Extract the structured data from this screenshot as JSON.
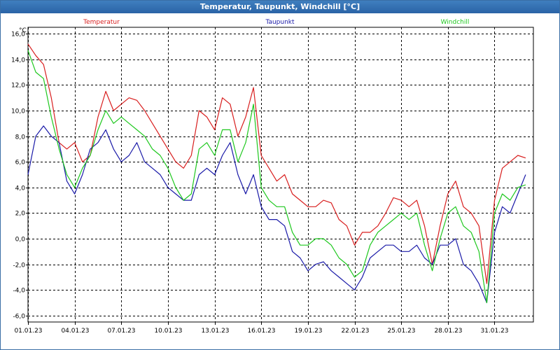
{
  "window": {
    "title": "Temperatur, Taupunkt, Windchill [°C]"
  },
  "colors": {
    "temperatur": "#d81e1e",
    "taupunkt": "#1a1aa8",
    "windchill": "#1ec81e",
    "grid": "#000000",
    "axis": "#000000"
  },
  "chart_data": {
    "type": "line",
    "title": "Temperatur, Taupunkt, Windchill [°C]",
    "unit": "°C",
    "xlabel": "",
    "ylabel": "°C",
    "ylim": [
      -6.5,
      16.5
    ],
    "xlim": [
      0,
      32.5
    ],
    "grid": true,
    "legend_position": "top",
    "x_ticks": [
      {
        "x": 0,
        "label": "01.01.23"
      },
      {
        "x": 3,
        "label": "04.01.23"
      },
      {
        "x": 6,
        "label": "07.01.23"
      },
      {
        "x": 9,
        "label": "10.01.23"
      },
      {
        "x": 12,
        "label": "13.01.23"
      },
      {
        "x": 15,
        "label": "16.01.23"
      },
      {
        "x": 18,
        "label": "19.01.23"
      },
      {
        "x": 21,
        "label": "22.01.23"
      },
      {
        "x": 24,
        "label": "25.01.23"
      },
      {
        "x": 27,
        "label": "28.01.23"
      },
      {
        "x": 30,
        "label": "31.01.23"
      }
    ],
    "y_ticks": [
      {
        "y": 16,
        "label": "16,0"
      },
      {
        "y": 14,
        "label": "14,0"
      },
      {
        "y": 12,
        "label": "12,0"
      },
      {
        "y": 10,
        "label": "10,0"
      },
      {
        "y": 8,
        "label": "8,0"
      },
      {
        "y": 6,
        "label": "6,0"
      },
      {
        "y": 4,
        "label": "4,0"
      },
      {
        "y": 2,
        "label": "2,0"
      },
      {
        "y": 0,
        "label": "0,0"
      },
      {
        "y": -2,
        "label": "-2,0"
      },
      {
        "y": -4,
        "label": "-4,0"
      },
      {
        "y": -6,
        "label": "-6,0"
      }
    ],
    "series": [
      {
        "name": "Temperatur",
        "color": "#d81e1e",
        "points": [
          [
            0,
            15.2
          ],
          [
            0.5,
            14.3
          ],
          [
            1,
            13.6
          ],
          [
            1.5,
            11.0
          ],
          [
            2,
            7.5
          ],
          [
            2.5,
            7.0
          ],
          [
            3,
            7.5
          ],
          [
            3.5,
            6.0
          ],
          [
            4,
            6.5
          ],
          [
            4.5,
            9.5
          ],
          [
            5,
            11.5
          ],
          [
            5.5,
            10.0
          ],
          [
            6,
            10.5
          ],
          [
            6.5,
            11.0
          ],
          [
            7,
            10.8
          ],
          [
            7.5,
            10.0
          ],
          [
            8,
            9.0
          ],
          [
            8.5,
            8.0
          ],
          [
            9,
            7.0
          ],
          [
            9.5,
            6.0
          ],
          [
            10,
            5.5
          ],
          [
            10.5,
            6.5
          ],
          [
            11,
            10.0
          ],
          [
            11.5,
            9.5
          ],
          [
            12,
            8.5
          ],
          [
            12.5,
            11.0
          ],
          [
            13,
            10.5
          ],
          [
            13.5,
            8.0
          ],
          [
            14,
            9.5
          ],
          [
            14.5,
            11.8
          ],
          [
            15,
            6.5
          ],
          [
            15.5,
            5.5
          ],
          [
            16,
            4.5
          ],
          [
            16.5,
            5.0
          ],
          [
            17,
            3.5
          ],
          [
            17.5,
            3.0
          ],
          [
            18,
            2.5
          ],
          [
            18.5,
            2.5
          ],
          [
            19,
            3.0
          ],
          [
            19.5,
            2.8
          ],
          [
            20,
            1.5
          ],
          [
            20.5,
            1.0
          ],
          [
            21,
            -0.5
          ],
          [
            21.5,
            0.5
          ],
          [
            22,
            0.5
          ],
          [
            22.5,
            1.0
          ],
          [
            23,
            2.0
          ],
          [
            23.5,
            3.2
          ],
          [
            24,
            3.0
          ],
          [
            24.5,
            2.5
          ],
          [
            25,
            3.0
          ],
          [
            25.5,
            1.0
          ],
          [
            26,
            -2.0
          ],
          [
            26.5,
            1.0
          ],
          [
            27,
            3.5
          ],
          [
            27.5,
            4.5
          ],
          [
            28,
            2.5
          ],
          [
            28.5,
            2.0
          ],
          [
            29,
            1.0
          ],
          [
            29.5,
            -3.5
          ],
          [
            30,
            3.0
          ],
          [
            30.5,
            5.5
          ],
          [
            31,
            6.0
          ],
          [
            31.5,
            6.5
          ],
          [
            32,
            6.3
          ]
        ]
      },
      {
        "name": "Taupunkt",
        "color": "#1a1aa8",
        "points": [
          [
            0,
            5.0
          ],
          [
            0.5,
            8.0
          ],
          [
            1,
            8.8
          ],
          [
            1.5,
            8.0
          ],
          [
            2,
            7.5
          ],
          [
            2.5,
            4.5
          ],
          [
            3,
            3.5
          ],
          [
            3.5,
            5.0
          ],
          [
            4,
            7.0
          ],
          [
            4.5,
            7.5
          ],
          [
            5,
            8.5
          ],
          [
            5.5,
            7.0
          ],
          [
            6,
            6.0
          ],
          [
            6.5,
            6.5
          ],
          [
            7,
            7.5
          ],
          [
            7.5,
            6.0
          ],
          [
            8,
            5.5
          ],
          [
            8.5,
            5.0
          ],
          [
            9,
            4.0
          ],
          [
            9.5,
            3.5
          ],
          [
            10,
            3.0
          ],
          [
            10.5,
            3.0
          ],
          [
            11,
            5.0
          ],
          [
            11.5,
            5.5
          ],
          [
            12,
            5.0
          ],
          [
            12.5,
            6.5
          ],
          [
            13,
            7.5
          ],
          [
            13.5,
            5.0
          ],
          [
            14,
            3.5
          ],
          [
            14.5,
            5.0
          ],
          [
            15,
            2.5
          ],
          [
            15.5,
            1.5
          ],
          [
            16,
            1.5
          ],
          [
            16.5,
            1.0
          ],
          [
            17,
            -1.0
          ],
          [
            17.5,
            -1.5
          ],
          [
            18,
            -2.5
          ],
          [
            18.5,
            -2.0
          ],
          [
            19,
            -1.8
          ],
          [
            19.5,
            -2.5
          ],
          [
            20,
            -3.0
          ],
          [
            20.5,
            -3.5
          ],
          [
            21,
            -4.0
          ],
          [
            21.5,
            -3.0
          ],
          [
            22,
            -1.5
          ],
          [
            22.5,
            -1.0
          ],
          [
            23,
            -0.5
          ],
          [
            23.5,
            -0.5
          ],
          [
            24,
            -1.0
          ],
          [
            24.5,
            -1.0
          ],
          [
            25,
            -0.5
          ],
          [
            25.5,
            -1.5
          ],
          [
            26,
            -2.0
          ],
          [
            26.5,
            -0.5
          ],
          [
            27,
            -0.5
          ],
          [
            27.5,
            0.0
          ],
          [
            28,
            -2.0
          ],
          [
            28.5,
            -2.5
          ],
          [
            29,
            -3.5
          ],
          [
            29.5,
            -5.0
          ],
          [
            30,
            0.5
          ],
          [
            30.5,
            2.5
          ],
          [
            31,
            2.0
          ],
          [
            31.5,
            3.5
          ],
          [
            32,
            5.0
          ]
        ]
      },
      {
        "name": "Windchill",
        "color": "#1ec81e",
        "points": [
          [
            0,
            14.7
          ],
          [
            0.5,
            13.0
          ],
          [
            1,
            12.5
          ],
          [
            1.5,
            9.5
          ],
          [
            2,
            7.0
          ],
          [
            2.5,
            5.0
          ],
          [
            3,
            4.0
          ],
          [
            3.5,
            5.5
          ],
          [
            4,
            6.5
          ],
          [
            4.5,
            8.5
          ],
          [
            5,
            10.0
          ],
          [
            5.5,
            9.0
          ],
          [
            6,
            9.5
          ],
          [
            6.5,
            9.0
          ],
          [
            7,
            8.5
          ],
          [
            7.5,
            8.0
          ],
          [
            8,
            7.0
          ],
          [
            8.5,
            6.5
          ],
          [
            9,
            5.5
          ],
          [
            9.5,
            4.0
          ],
          [
            10,
            3.0
          ],
          [
            10.5,
            3.5
          ],
          [
            11,
            7.0
          ],
          [
            11.5,
            7.5
          ],
          [
            12,
            6.5
          ],
          [
            12.5,
            8.5
          ],
          [
            13,
            8.5
          ],
          [
            13.5,
            6.0
          ],
          [
            14,
            7.5
          ],
          [
            14.5,
            10.5
          ],
          [
            15,
            4.0
          ],
          [
            15.5,
            3.0
          ],
          [
            16,
            2.5
          ],
          [
            16.5,
            2.5
          ],
          [
            17,
            0.5
          ],
          [
            17.5,
            -0.5
          ],
          [
            18,
            -0.5
          ],
          [
            18.5,
            0.0
          ],
          [
            19,
            0.0
          ],
          [
            19.5,
            -0.5
          ],
          [
            20,
            -1.5
          ],
          [
            20.5,
            -2.0
          ],
          [
            21,
            -3.0
          ],
          [
            21.5,
            -2.5
          ],
          [
            22,
            -0.5
          ],
          [
            22.5,
            0.5
          ],
          [
            23,
            1.0
          ],
          [
            23.5,
            1.5
          ],
          [
            24,
            2.0
          ],
          [
            24.5,
            1.5
          ],
          [
            25,
            2.0
          ],
          [
            25.5,
            -0.5
          ],
          [
            26,
            -2.5
          ],
          [
            26.5,
            0.0
          ],
          [
            27,
            2.0
          ],
          [
            27.5,
            2.5
          ],
          [
            28,
            1.0
          ],
          [
            28.5,
            0.5
          ],
          [
            29,
            -1.0
          ],
          [
            29.5,
            -5.0
          ],
          [
            30,
            2.0
          ],
          [
            30.5,
            3.5
          ],
          [
            31,
            3.0
          ],
          [
            31.5,
            4.0
          ],
          [
            32,
            4.2
          ]
        ]
      }
    ]
  }
}
